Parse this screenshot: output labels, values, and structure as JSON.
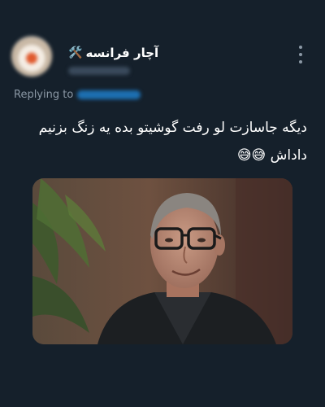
{
  "tweet": {
    "display_name": "آچار فرانسه",
    "name_icon": "hammer-and-wrench-icon",
    "more_icon": "more-options-icon",
    "replying_to_label": "Replying to",
    "text": "دیگه جاسازت لو رفت گوشیتو بده یه زنگ بزنیم داداش 😅😅",
    "media_icon": "photo-of-smiling-man-in-glasses"
  },
  "colors": {
    "background": "#15202b",
    "text_primary": "#ffffff",
    "text_secondary": "#8b98a5",
    "link": "#1d9bf0"
  }
}
